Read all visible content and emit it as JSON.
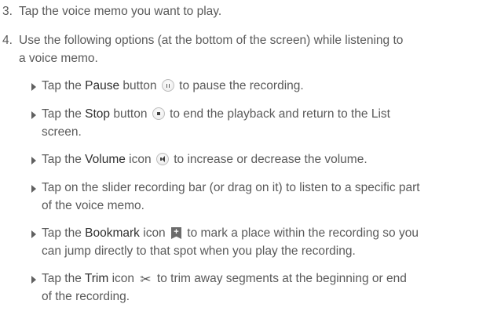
{
  "steps": [
    {
      "number": "3.",
      "text": "Tap the voice memo you want to play."
    },
    {
      "number": "4.",
      "text_line1": "Use the following options (at the bottom of the screen) while listening to",
      "text_line2": "a voice memo."
    }
  ],
  "bullets": {
    "pause": {
      "pre": "Tap the ",
      "keyword": "Pause",
      "mid": " button",
      "post": " to pause the recording.",
      "icon": "pause-button-icon"
    },
    "stop": {
      "pre": "Tap the ",
      "keyword": "Stop",
      "mid": " button",
      "post_line1": " to end the playback and return to the List",
      "post_line2": "screen.",
      "icon": "stop-button-icon"
    },
    "volume": {
      "pre": "Tap the ",
      "keyword": "Volume",
      "mid": " icon",
      "post": " to increase or decrease the volume.",
      "icon": "volume-icon"
    },
    "slider": {
      "line1": "Tap on the slider recording bar (or drag on it) to listen to a specific part",
      "line2": "of the voice memo."
    },
    "bookmark": {
      "pre": "Tap the ",
      "keyword": "Bookmark",
      "mid": " icon",
      "post_line1": " to mark a place within the recording so you",
      "post_line2": "can jump directly to that spot when you play the recording.",
      "icon": "bookmark-icon"
    },
    "trim": {
      "pre": "Tap the ",
      "keyword": "Trim",
      "mid": " icon",
      "post_line1": " to trim away segments at the beginning or end",
      "post_line2": "of the recording.",
      "icon": "scissors-icon"
    }
  }
}
